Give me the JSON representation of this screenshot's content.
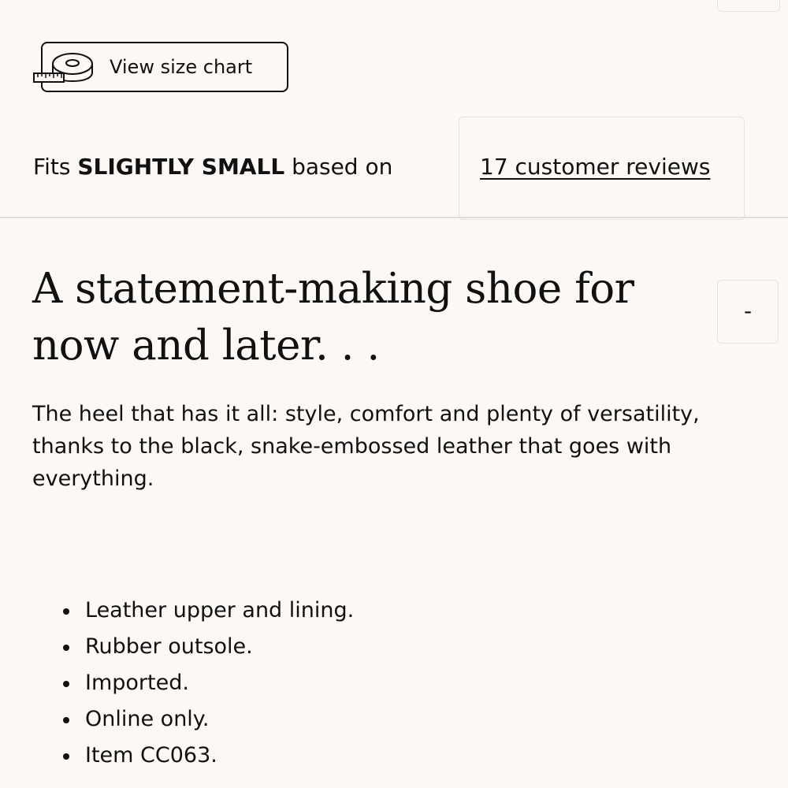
{
  "size_chart": {
    "label": "View size chart",
    "icon": "measuring-tape-icon"
  },
  "fit": {
    "prefix": "Fits",
    "rating": "SLIGHTLY SMALL",
    "suffix": "based on",
    "reviews_link": "17 customer reviews"
  },
  "details": {
    "headline_line1": "A statement-making shoe for",
    "headline_line2": "now and later. . .",
    "collapse_label": "-",
    "description": "The heel that has it all: style, comfort and plenty of versatility, thanks to the black, snake-embossed leather that goes with everything.",
    "features": [
      "Leather upper and lining.",
      "Rubber outsole.",
      "Imported.",
      "Online only.",
      "Item CC063."
    ]
  },
  "colors": {
    "background": "#fbf8f5",
    "text": "#111111",
    "border": "#e7e3df"
  }
}
